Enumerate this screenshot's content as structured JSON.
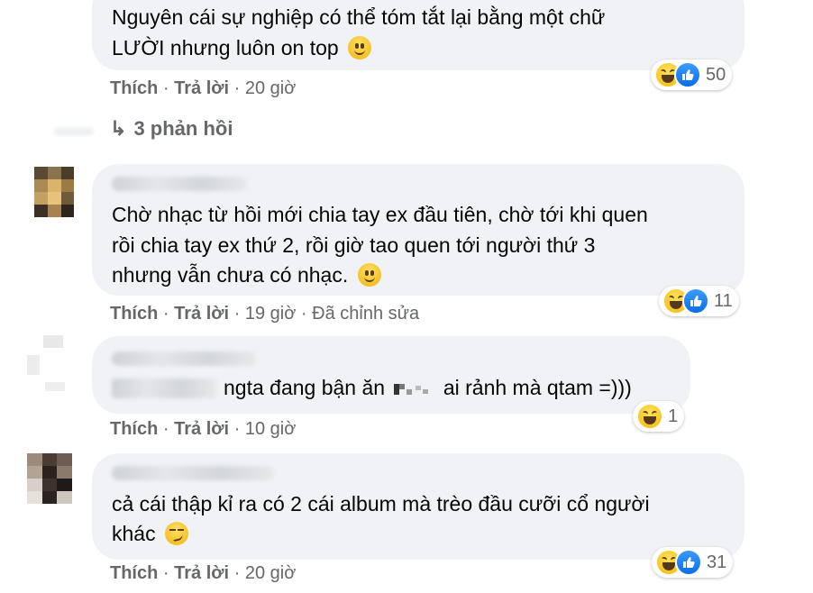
{
  "reply_labels": {
    "like": "Thích",
    "reply": "Trả lời",
    "sep": "·"
  },
  "comments": [
    {
      "lines": [
        "Nguyên cái sự nghiệp có thể tóm tắt lại bằng một chữ",
        "LƯỜI nhưng luôn on top"
      ],
      "time": "20 giờ",
      "reaction_count": "50",
      "emoji": "smiling-face"
    },
    {
      "lines": [
        "Chờ nhạc từ hồi mới chia tay ex đầu tiên, chờ tới khi quen",
        "rồi chia tay ex thứ 2, rồi giờ tao quen tới người thứ 3",
        "nhưng vẫn chưa có nhạc."
      ],
      "time": "19 giờ",
      "edited": "Đã chỉnh sửa",
      "reaction_count": "11",
      "emoji": "smiling-face"
    },
    {
      "line_a": "ngta đang bận ăn",
      "line_b": "ai rảnh mà qtam =)))",
      "time": "10 giờ",
      "reaction_count": "1"
    },
    {
      "lines": [
        "cả cái thập kỉ ra có 2 cái album mà trèo đầu cưỡi cổ người",
        "khác"
      ],
      "time": "20 giờ",
      "reaction_count": "31",
      "emoji": "smirking-face"
    }
  ],
  "view_replies": {
    "arrow": "↳",
    "label": "3 phản hồi"
  },
  "colors": {
    "bubble": "#f0f2f5",
    "meta": "#65676b",
    "text": "#050505",
    "like_blue": "#1877f2",
    "haha_yellow": "#f7c33b"
  }
}
